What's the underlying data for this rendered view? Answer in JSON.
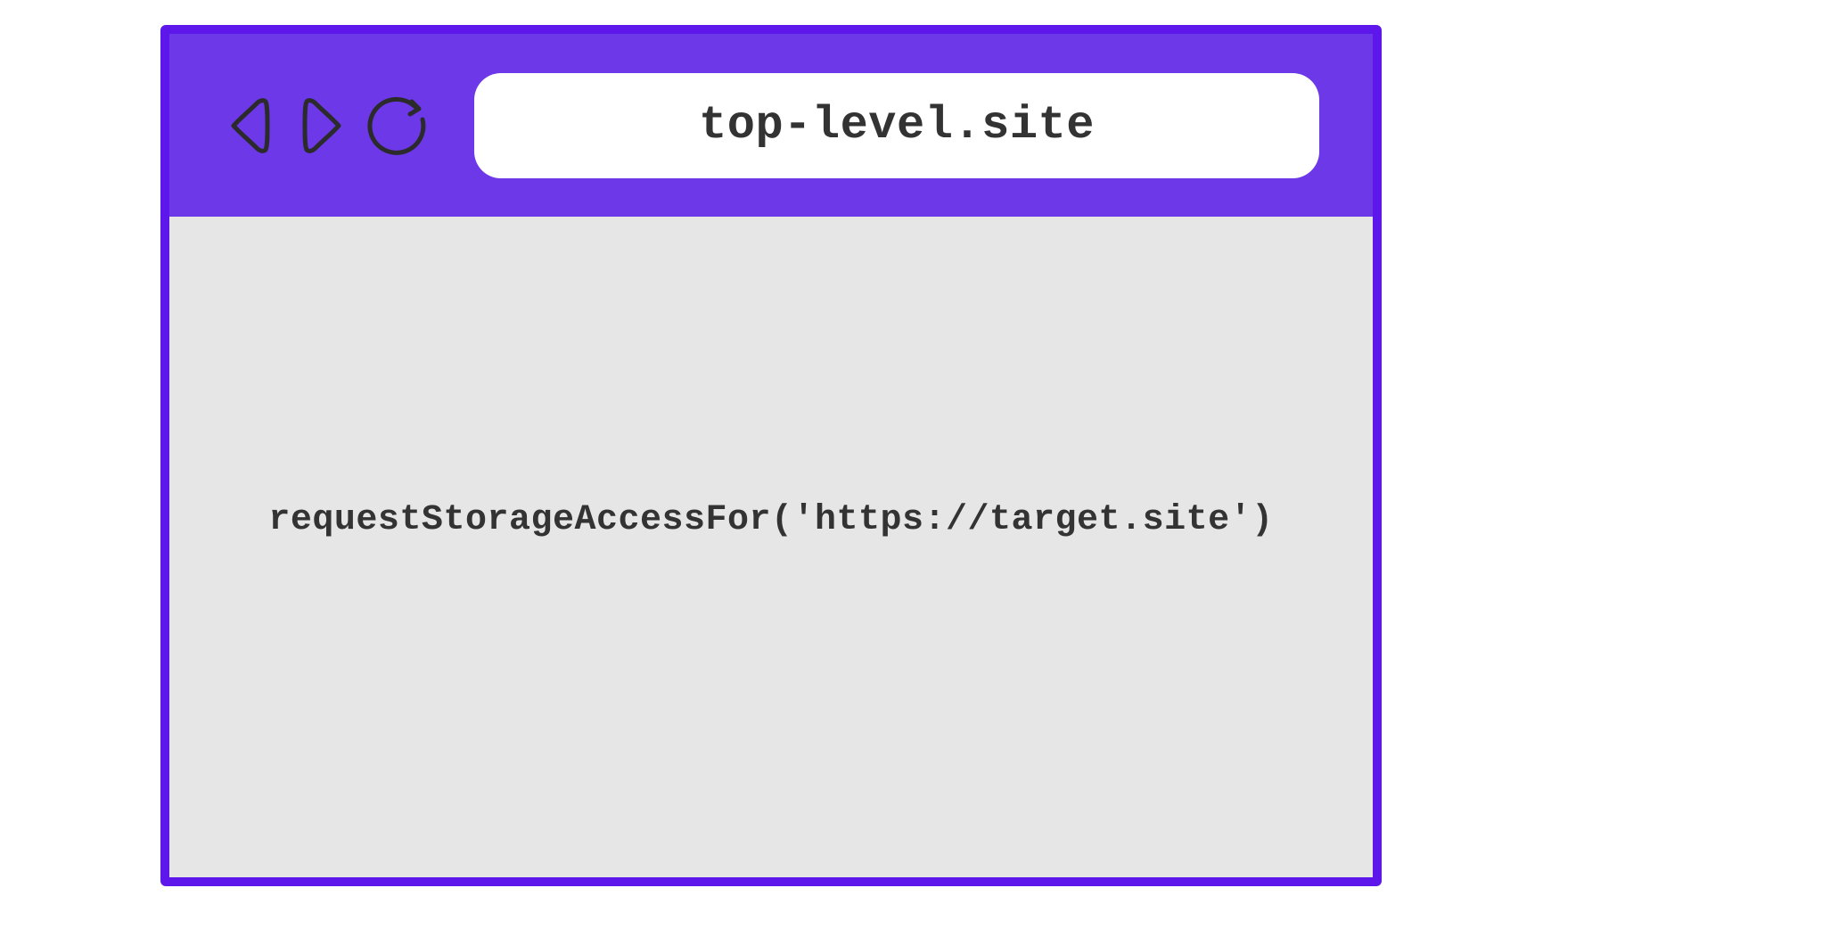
{
  "browser": {
    "address": "top-level.site",
    "icons": {
      "back": "back-icon",
      "forward": "forward-icon",
      "reload": "reload-icon"
    }
  },
  "content": {
    "code": "requestStorageAccessFor('https://target.site')"
  },
  "colors": {
    "chrome_bg": "#6d38e8",
    "border": "#5e17eb",
    "content_bg": "#e6e6e6",
    "text": "#333333",
    "address_bg": "#ffffff"
  }
}
